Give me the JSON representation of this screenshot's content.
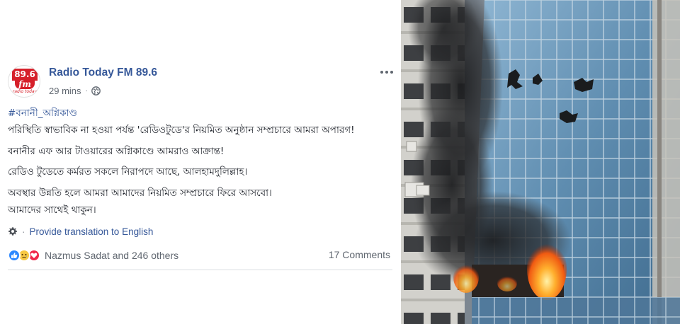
{
  "post": {
    "page_name": "Radio Today FM 89.6",
    "avatar": {
      "freq": "89.6",
      "mark": "fm",
      "tagline": "radio today"
    },
    "time": "29 mins",
    "privacy_icon": "globe-icon",
    "menu_icon": "more-horizontal-icon",
    "hashtag": "#বনানী_অগ্নিকাণ্ড",
    "lines": [
      "পরিস্থিতি স্বাভাবিক না হওয়া পর্যন্ত 'রেডিওটুডে'র নিয়মিত অনুষ্ঠান সম্প্রচারে আমরা অপারগ!",
      "বনানীর এফ আর টাওয়ারের অগ্নিকাণ্ডে আমরাও আক্রান্ত!",
      "রেডিও টুডেতে কর্মরত সকলে নিরাপদে আছে, আলহামদুলিল্লাহ।",
      "অবস্থার উন্নতি হলে আমরা আমাদের নিয়মিত সম্প্রচারে ফিরে আসবো।",
      "আমাদের সাথেই থাকুন।"
    ],
    "translate_link": "Provide translation to English",
    "reactions": {
      "icons": [
        "like-icon",
        "sad-icon",
        "love-icon"
      ],
      "summary": "Nazmus Sadat and 246 others"
    },
    "comments": "17 Comments"
  },
  "colors": {
    "link": "#365899",
    "meta": "#606770",
    "text": "#1d2129",
    "like": "#2d88ff",
    "sad": "#f7c843",
    "love": "#f0284a",
    "brand_red": "#d6202a"
  }
}
